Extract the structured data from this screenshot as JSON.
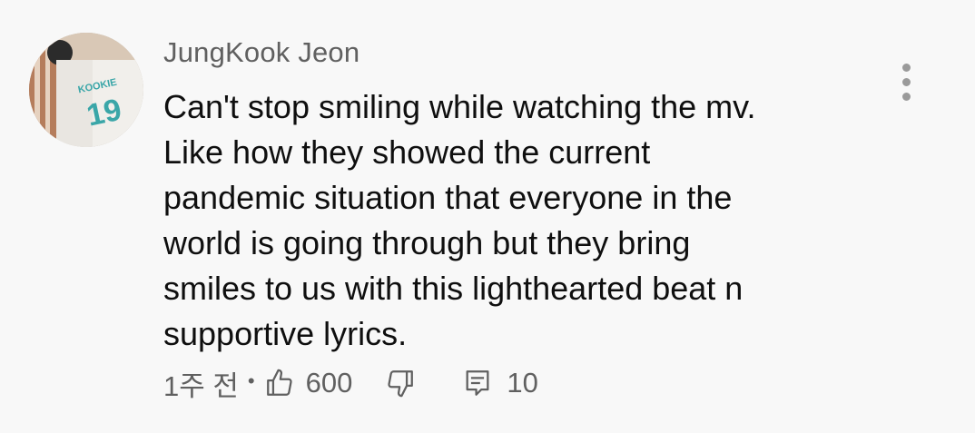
{
  "comment": {
    "author": "JungKook Jeon",
    "text_lines": [
      "Can't stop smiling while watching the mv.",
      "Like how they showed the current",
      "pandemic situation that everyone in the",
      "world is going through but they bring",
      "smiles to us with this lighthearted beat n",
      "supportive lyrics."
    ],
    "time_ago": "1주 전",
    "separator": "•",
    "like_count": "600",
    "reply_count": "10",
    "avatar": {
      "jersey_name": "KOOKIE",
      "jersey_number": "19"
    }
  },
  "icons": {
    "menu": "more-vert-icon",
    "like": "thumbs-up-icon",
    "dislike": "thumbs-down-icon",
    "reply": "comment-icon"
  },
  "colors": {
    "background": "#f8f8f8",
    "text_primary": "#0f0f0f",
    "text_secondary": "#606060",
    "jersey_teal": "#3aa6a8"
  }
}
